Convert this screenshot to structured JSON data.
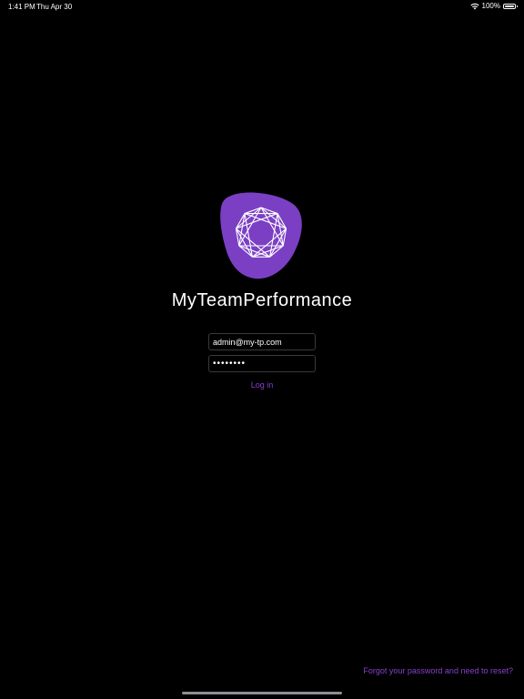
{
  "status_bar": {
    "time": "1:41 PM",
    "date": "Thu Apr 30",
    "battery_percent": "100%",
    "battery_level": 1.0,
    "wifi_icon": "wifi-icon",
    "battery_icon": "battery-icon"
  },
  "app": {
    "title": "MyTeamPerformance",
    "logo_icon": "gem-logo-icon",
    "brand_color": "#7b3fc4",
    "accent_color": "#8a3fd0"
  },
  "login": {
    "email_value": "admin@my-tp.com",
    "password_value": "••••••••",
    "login_label": "Log in",
    "forgot_label": "Forgot your password and need to reset?"
  }
}
